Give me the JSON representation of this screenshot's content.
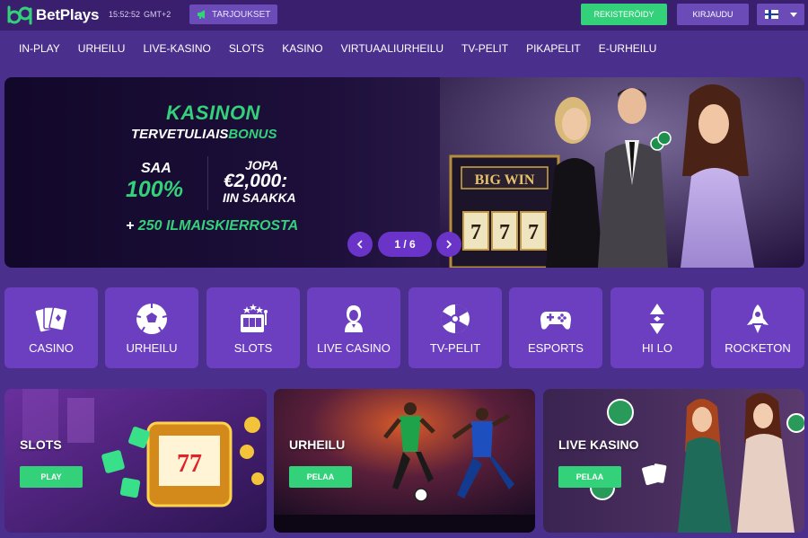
{
  "brand": {
    "name": "BetPlays",
    "green": "#33d17a",
    "purple": "#6b3fbf"
  },
  "topbar": {
    "time": "15:52:52",
    "timezone": "GMT+2",
    "promo_label": "TARJOUKSET",
    "register_label": "REKISTERÖIDY",
    "login_label": "KIRJAUDU",
    "language_flag": "finland-flag-icon"
  },
  "nav": {
    "items": [
      "IN-PLAY",
      "URHEILU",
      "LIVE-KASINO",
      "SLOTS",
      "KASINO",
      "VIRTUAALIURHEILU",
      "TV-PELIT",
      "PIKAPELIT",
      "E-URHEILU"
    ]
  },
  "hero": {
    "headline": "KASINON",
    "subline_a": "TERVETULIAIS",
    "subline_b": "BONUS",
    "saa": "SAA",
    "percent": "100%",
    "jopa": "JOPA",
    "amount": "€2,000:",
    "iin_saakka": "IIN SAAKKA",
    "spins_plus": "+ ",
    "spins": "250 ILMAISKIERROSTA",
    "pager": "1 / 6",
    "slot_sign": "BIG WIN",
    "slot_reels": [
      "7",
      "7",
      "7"
    ]
  },
  "categories": [
    {
      "label": "CASINO",
      "icon": "cards-icon"
    },
    {
      "label": "URHEILU",
      "icon": "football-icon"
    },
    {
      "label": "SLOTS",
      "icon": "slot-machine-icon"
    },
    {
      "label": "LIVE CASINO",
      "icon": "live-dealer-icon"
    },
    {
      "label": "TV-PELIT",
      "icon": "wheel-icon"
    },
    {
      "label": "ESPORTS",
      "icon": "gamepad-icon"
    },
    {
      "label": "HI LO",
      "icon": "hi-lo-icon"
    },
    {
      "label": "ROCKETON",
      "icon": "rocket-icon"
    }
  ],
  "cards": [
    {
      "title": "SLOTS",
      "button": "PLAY"
    },
    {
      "title": "URHEILU",
      "button": "PELAA"
    },
    {
      "title": "LIVE KASINO",
      "button": "PELAA"
    }
  ]
}
